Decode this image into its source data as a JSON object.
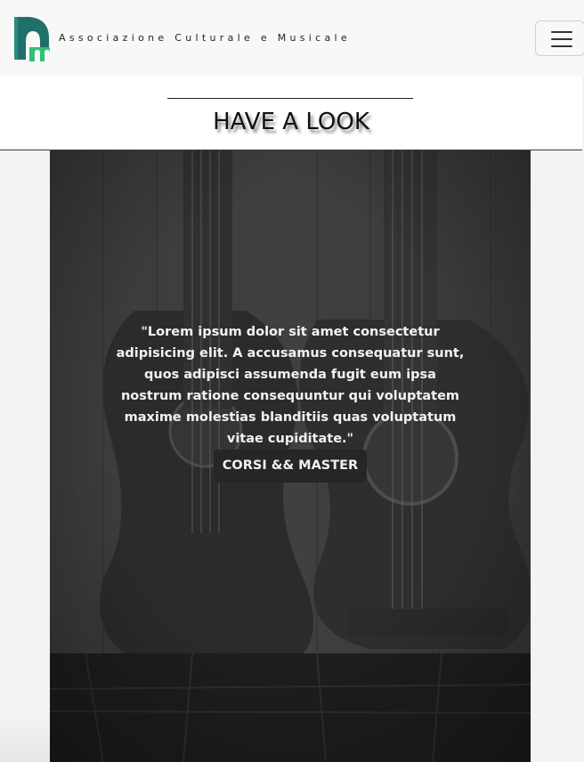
{
  "navbar": {
    "brand_text": "Associazione Culturale e Musicale",
    "logo_icon": "pro-music-logo-icon",
    "menu_icon": "hamburger-menu-icon"
  },
  "section": {
    "title": "HAVE A LOOK"
  },
  "hero": {
    "quote": "\"Lorem ipsum dolor sit amet consectetur adipisicing elit. A accusamus consequatur sunt, quos adipisci assumenda fugit eum ipsa nostrum ratione consequuntur qui voluptatem maxime molestias blanditiis quas voluptatum vitae cupiditate.\"",
    "button_label": "CORSI && MASTER"
  },
  "colors": {
    "logo_teal": "#1f6f6a",
    "logo_green": "#2fb36b",
    "overlay": "#333333"
  }
}
